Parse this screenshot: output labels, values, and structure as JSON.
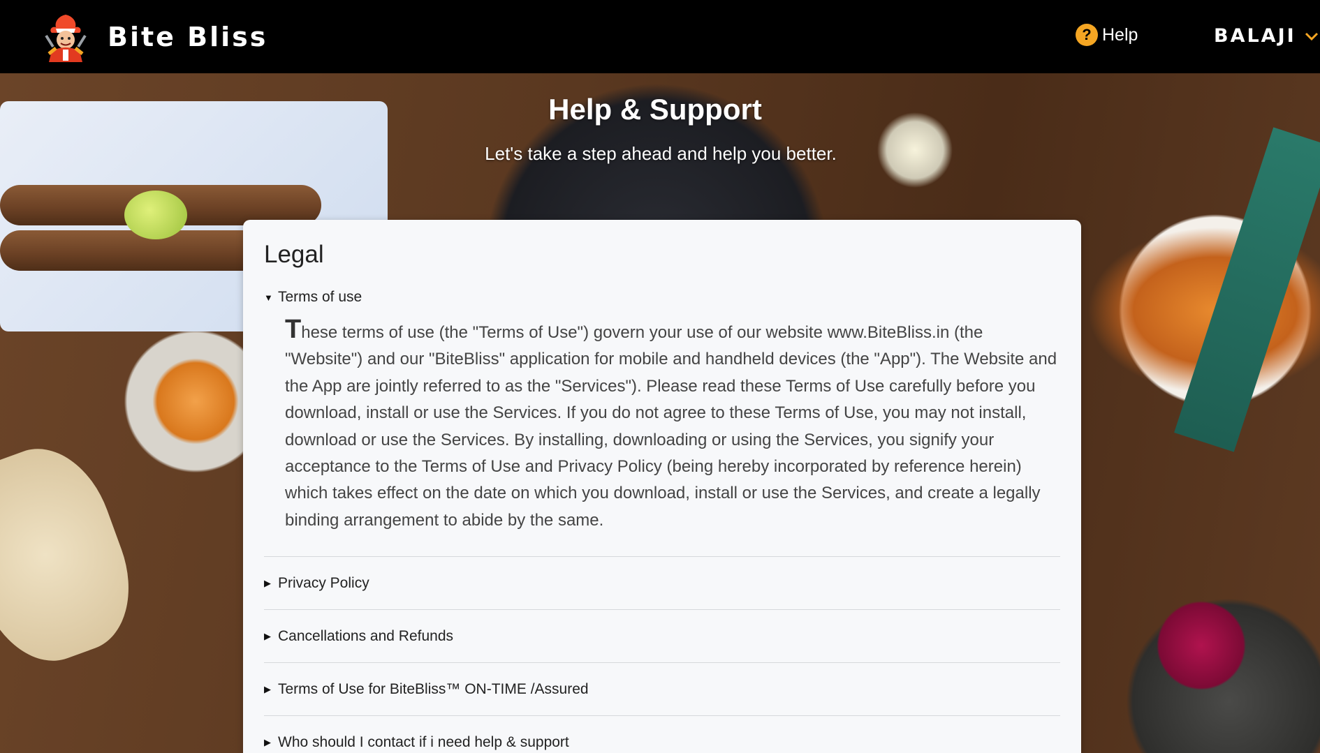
{
  "header": {
    "brand_name": "Bite Bliss",
    "help_label": "Help",
    "user_name": "BALAJI"
  },
  "hero": {
    "title": "Help & Support",
    "subtitle": "Let's take a step ahead and help you better."
  },
  "legal": {
    "title": "Legal",
    "items": [
      {
        "label": "Terms of use",
        "expanded": true,
        "dropcap": "T",
        "body": "hese terms of use (the \"Terms of Use\") govern your use of our website www.BiteBliss.in (the \"Website\") and our \"BiteBliss\" application for mobile and handheld devices (the \"App\"). The Website and the App are jointly referred to as the \"Services\"). Please read these Terms of Use carefully before you download, install or use the Services. If you do not agree to these Terms of Use, you may not install, download or use the Services. By installing, downloading or using the Services, you signify your acceptance to the Terms of Use and Privacy Policy (being hereby incorporated by reference herein) which takes effect on the date on which you download, install or use the Services, and create a legally binding arrangement to abide by the same."
      },
      {
        "label": "Privacy Policy",
        "expanded": false
      },
      {
        "label": "Cancellations and Refunds",
        "expanded": false
      },
      {
        "label": "Terms of Use for BiteBliss™ ON-TIME /Assured",
        "expanded": false
      },
      {
        "label": "Who should I contact if i need help & support",
        "expanded": false
      }
    ]
  },
  "colors": {
    "header_bg": "#000000",
    "help_icon": "#f5a623",
    "card_bg": "#f7f8fa"
  },
  "icons": {
    "logo": "chef-mascot-logo",
    "help": "question-circle-icon",
    "user_menu": "chevron-down-icon",
    "expanded": "triangle-down-icon",
    "collapsed": "triangle-right-icon"
  }
}
